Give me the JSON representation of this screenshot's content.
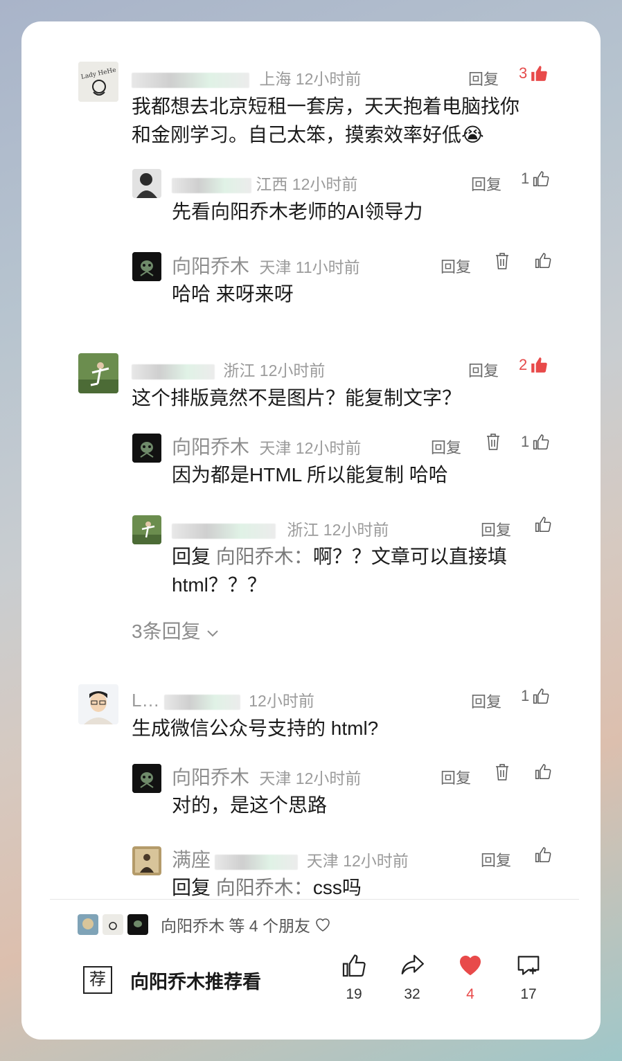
{
  "comments": [
    {
      "name_masked": "…",
      "location": "上海",
      "time": "12小时前",
      "reply_label": "回复",
      "likes": "3",
      "text_lines": [
        "我都想去北京短租一套房，天天抱着电脑找你",
        "和金刚学习。自己太笨，摸索效率好低😭"
      ],
      "replies": [
        {
          "name_masked": "…",
          "location": "江西",
          "time": "12小时前",
          "reply_label": "回复",
          "likes": "1",
          "text": "先看向阳乔木老师的AI领导力"
        },
        {
          "name": "向阳乔木",
          "location": "天津",
          "time": "11小时前",
          "reply_label": "回复",
          "likes": "",
          "text": "哈哈 来呀来呀"
        }
      ]
    },
    {
      "name_masked": "…",
      "location": "浙江",
      "time": "12小时前",
      "reply_label": "回复",
      "likes": "2",
      "text_lines": [
        "这个排版竟然不是图片？能复制文字？"
      ],
      "replies": [
        {
          "name": "向阳乔木",
          "location": "天津",
          "time": "12小时前",
          "reply_label": "回复",
          "likes": "1",
          "text": "因为都是HTML 所以能复制 哈哈"
        },
        {
          "name_masked": "…",
          "location": "浙江",
          "time": "12小时前",
          "reply_label": "回复",
          "likes": "",
          "text_prefix": "回复",
          "text_target": "向阳乔木：",
          "text_lines": [
            "啊？？文章可以直接填",
            "html？？？"
          ]
        }
      ],
      "more_replies": "3条回复"
    },
    {
      "name_masked": "L…",
      "location": "",
      "time": "12小时前",
      "reply_label": "回复",
      "likes": "1",
      "text_lines": [
        "生成微信公众号支持的 html?"
      ],
      "replies": [
        {
          "name": "向阳乔木",
          "location": "天津",
          "time": "12小时前",
          "reply_label": "回复",
          "likes": "",
          "text": "对的，是这个思路"
        },
        {
          "name": "满座",
          "location": "天津",
          "time": "12小时前",
          "reply_label": "回复",
          "likes": "",
          "text_prefix": "回复",
          "text_target": "向阳乔木：",
          "text": "css吗"
        }
      ]
    }
  ],
  "friends_bar": {
    "text": "向阳乔木 等 4 个朋友"
  },
  "bottom": {
    "recommend_icon": "荐",
    "recommend_label": "向阳乔木推荐看",
    "actions": [
      {
        "name": "like",
        "count": "19"
      },
      {
        "name": "share",
        "count": "32"
      },
      {
        "name": "heart",
        "count": "4",
        "color": "#e84a4a"
      },
      {
        "name": "comment",
        "count": "17"
      }
    ]
  }
}
